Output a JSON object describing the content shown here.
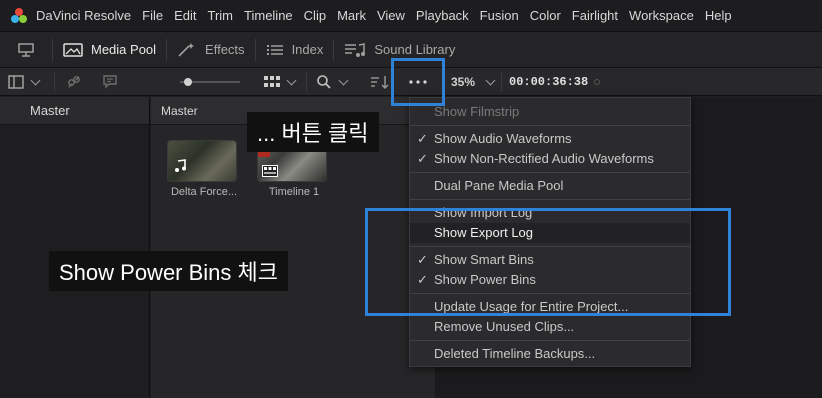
{
  "menubar": {
    "items": [
      "DaVinci Resolve",
      "File",
      "Edit",
      "Trim",
      "Timeline",
      "Clip",
      "Mark",
      "View",
      "Playback",
      "Fusion",
      "Color",
      "Fairlight",
      "Workspace",
      "Help"
    ]
  },
  "tabs": {
    "media_pool": "Media Pool",
    "effects": "Effects",
    "index": "Index",
    "sound_library": "Sound Library"
  },
  "toolbar": {
    "zoom": "35%",
    "timecode": "00:00:36:38"
  },
  "left_panel": {
    "header": "Master"
  },
  "media_panel": {
    "header": "Master",
    "clips": [
      {
        "label": "Delta Force..."
      },
      {
        "label": "Timeline 1"
      }
    ]
  },
  "dropdown": {
    "items": [
      {
        "label": "Show Filmstrip",
        "checked": false,
        "dim": true
      },
      {
        "label": "Show Audio Waveforms",
        "checked": true
      },
      {
        "label": "Show Non-Rectified Audio Waveforms",
        "checked": true
      },
      {
        "label": "Dual Pane Media Pool",
        "checked": false
      },
      {
        "label": "Show Import Log",
        "checked": false
      },
      {
        "label": "Show Export Log",
        "checked": false,
        "hover": true
      },
      {
        "label": "Show Smart Bins",
        "checked": true
      },
      {
        "label": "Show Power Bins",
        "checked": true
      },
      {
        "label": "Update Usage for Entire Project...",
        "checked": false
      },
      {
        "label": "Remove Unused Clips...",
        "checked": false
      },
      {
        "label": "Deleted Timeline Backups...",
        "checked": false
      }
    ]
  },
  "annotations": {
    "button_click": "... 버튼 클릭",
    "power_bins": "Show Power Bins 체크",
    "highlight_color": "#2e83d8"
  }
}
